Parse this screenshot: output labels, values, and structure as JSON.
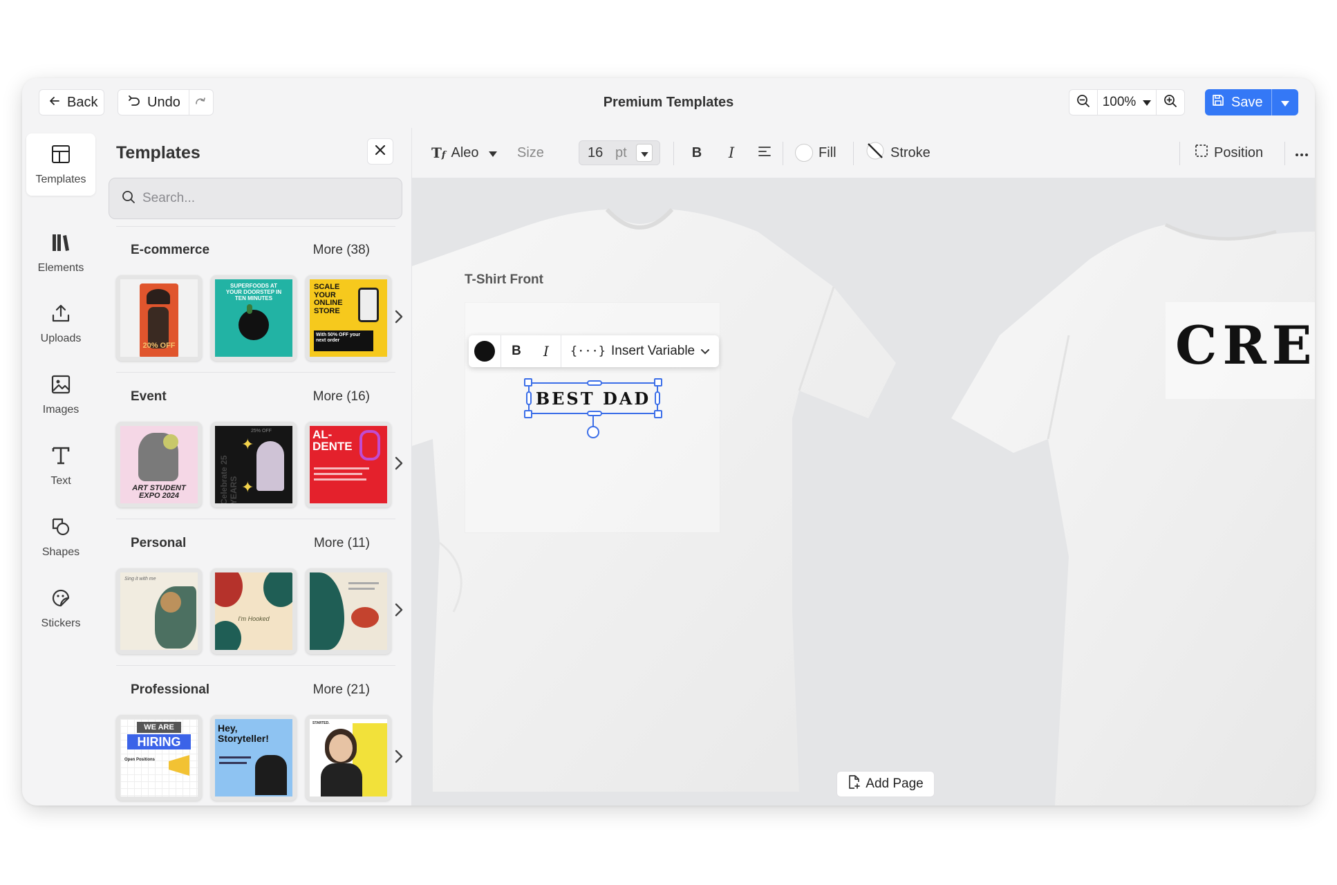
{
  "topbar": {
    "back_label": "Back",
    "undo_label": "Undo",
    "title": "Premium Templates",
    "zoom_value": "100%",
    "save_label": "Save"
  },
  "rail": {
    "items": [
      {
        "label": "Templates",
        "icon": "templates-icon",
        "active": true
      },
      {
        "label": "Elements",
        "icon": "elements-icon"
      },
      {
        "label": "Uploads",
        "icon": "upload-icon"
      },
      {
        "label": "Images",
        "icon": "image-icon"
      },
      {
        "label": "Text",
        "icon": "text-icon"
      },
      {
        "label": "Shapes",
        "icon": "shapes-icon"
      },
      {
        "label": "Stickers",
        "icon": "sticker-icon"
      }
    ]
  },
  "panel": {
    "title": "Templates",
    "search_placeholder": "Search...",
    "sections": [
      {
        "name": "E-commerce",
        "more": "More (38)",
        "thumbs": [
          {
            "texts": [
              "20% OFF"
            ],
            "bg": "#f2f2f2",
            "accent": "#e0552d"
          },
          {
            "texts": [
              "SUPERFOODS AT YOUR DOORSTEP IN TEN MINUTES"
            ],
            "bg": "#22b3a4",
            "accent": "#111111"
          },
          {
            "texts": [
              "SCALE YOUR ONLINE STORE",
              "With 50% OFF your next order"
            ],
            "bg": "#f6c91d",
            "accent": "#111111"
          }
        ]
      },
      {
        "name": "Event",
        "more": "More (16)",
        "thumbs": [
          {
            "texts": [
              "ART STUDENT EXPO 2024"
            ],
            "bg": "#f5d7e6",
            "accent": "#222222"
          },
          {
            "texts": [
              "Celebrate 25 YEARS",
              "25% OFF"
            ],
            "bg": "#151515",
            "accent": "#f2d24b"
          },
          {
            "texts": [
              "AL-DENTE"
            ],
            "bg": "#e4212c",
            "accent": "#ffffff"
          }
        ]
      },
      {
        "name": "Personal",
        "more": "More (11)",
        "thumbs": [
          {
            "texts": [
              "Sing it with me"
            ],
            "bg": "#f1ece0",
            "accent": "#2f5b4a"
          },
          {
            "texts": [
              "I'm Hooked"
            ],
            "bg": "#f3e3c6",
            "accent": "#b5322b"
          },
          {
            "texts": [
              ""
            ],
            "bg": "#eee7d8",
            "accent": "#1f5e55"
          }
        ]
      },
      {
        "name": "Professional",
        "more": "More (21)",
        "thumbs": [
          {
            "texts": [
              "WE ARE",
              "HIRING",
              "Open Positions"
            ],
            "bg": "#ffffff",
            "accent": "#3b63e8"
          },
          {
            "texts": [
              "Hey, Storyteller!"
            ],
            "bg": "#8ec3f2",
            "accent": "#111111"
          },
          {
            "texts": [
              "STARTED."
            ],
            "bg": "#ffffff",
            "accent": "#f2e13a"
          }
        ]
      }
    ]
  },
  "toolbar": {
    "font_name": "Aleo",
    "size_label": "Size",
    "size_value": "16",
    "size_unit": "pt",
    "fill_label": "Fill",
    "stroke_label": "Stroke",
    "position_label": "Position"
  },
  "canvas": {
    "page_label": "T-Shirt Front",
    "selected_text": "BEST DAD",
    "back_text": "CREW",
    "insert_variable_label": "Insert Variable",
    "add_page_label": "Add Page"
  },
  "colors": {
    "accent": "#3478f6",
    "selection": "#3b6ee8",
    "text_color": "#111111"
  }
}
